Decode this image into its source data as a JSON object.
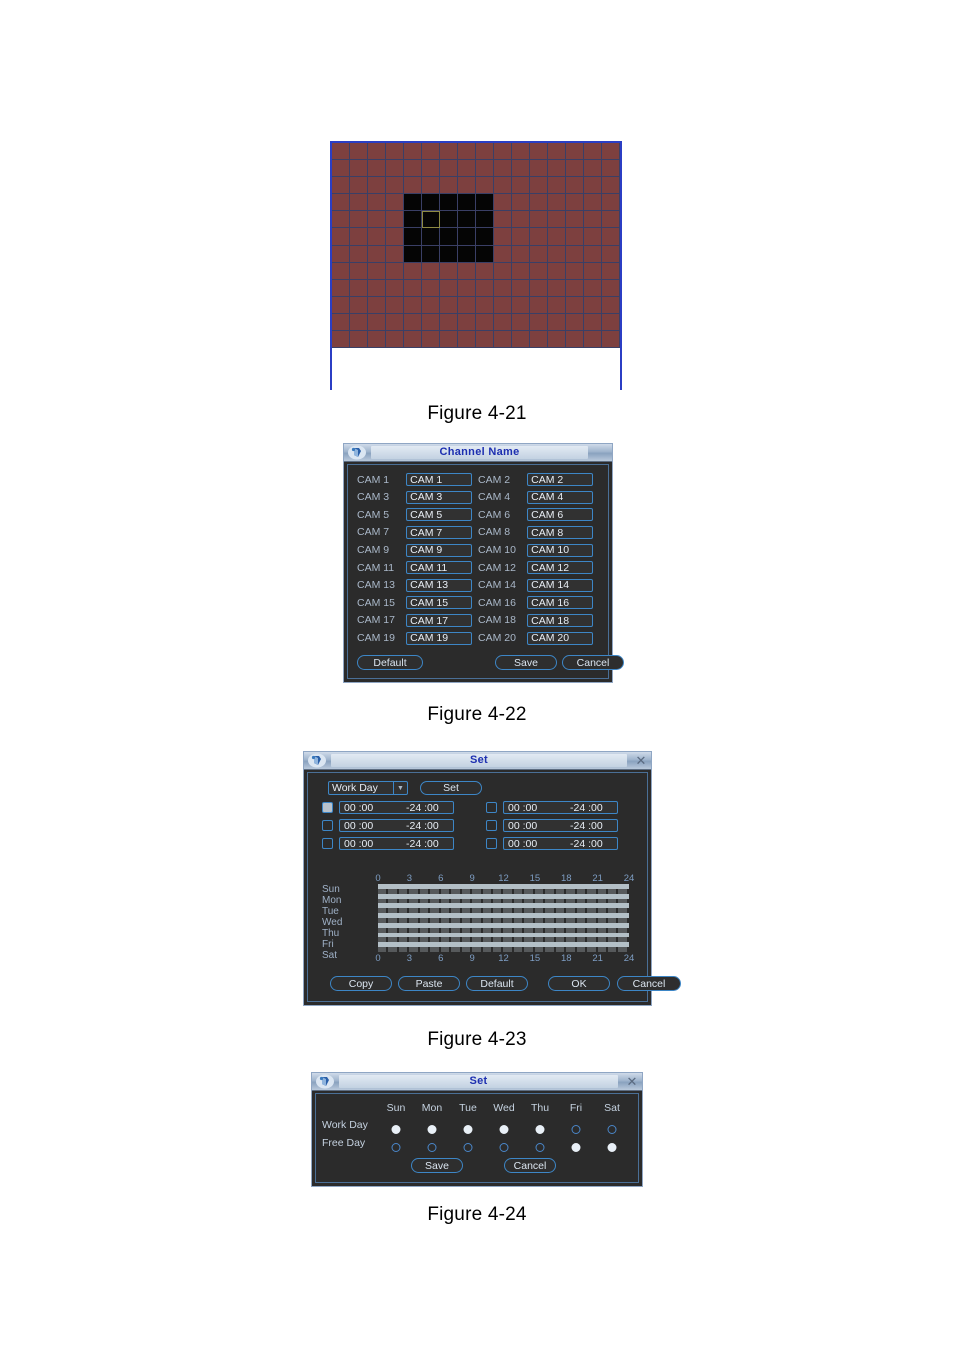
{
  "figures": {
    "fig21_caption": "Figure 4-21",
    "fig22_caption": "Figure 4-22",
    "fig23_caption": "Figure 4-23",
    "fig24_caption": "Figure 4-24"
  },
  "motion_grid": {
    "columns": 16,
    "rows": 12,
    "active_color": "#7d403f",
    "inactive_color": "#050505",
    "gridline_color": "#3a3f66",
    "border_color": "#2b3ec4",
    "cursor_cell": {
      "col": 5,
      "row": 4
    },
    "deselected_region": {
      "col_start": 4,
      "col_end": 8,
      "row_start": 3,
      "row_end": 6
    }
  },
  "channel_name_dialog": {
    "title": "Channel Name",
    "icon": "dvr-logo-icon",
    "rows": [
      {
        "label_left": "CAM 1",
        "value_left": "CAM 1",
        "label_right": "CAM 2",
        "value_right": "CAM 2"
      },
      {
        "label_left": "CAM 3",
        "value_left": "CAM 3",
        "label_right": "CAM 4",
        "value_right": "CAM 4"
      },
      {
        "label_left": "CAM 5",
        "value_left": "CAM 5",
        "label_right": "CAM 6",
        "value_right": "CAM 6"
      },
      {
        "label_left": "CAM 7",
        "value_left": "CAM 7",
        "label_right": "CAM 8",
        "value_right": "CAM 8"
      },
      {
        "label_left": "CAM 9",
        "value_left": "CAM 9",
        "label_right": "CAM 10",
        "value_right": "CAM 10"
      },
      {
        "label_left": "CAM 11",
        "value_left": "CAM 11",
        "label_right": "CAM 12",
        "value_right": "CAM 12"
      },
      {
        "label_left": "CAM 13",
        "value_left": "CAM 13",
        "label_right": "CAM 14",
        "value_right": "CAM 14"
      },
      {
        "label_left": "CAM 15",
        "value_left": "CAM 15",
        "label_right": "CAM 16",
        "value_right": "CAM 16"
      },
      {
        "label_left": "CAM 17",
        "value_left": "CAM 17",
        "label_right": "CAM 18",
        "value_right": "CAM 18"
      },
      {
        "label_left": "CAM 19",
        "value_left": "CAM 19",
        "label_right": "CAM 20",
        "value_right": "CAM 20"
      }
    ],
    "buttons": {
      "default": "Default",
      "save": "Save",
      "cancel": "Cancel"
    }
  },
  "schedule_dialog": {
    "title": "Set",
    "icon": "dvr-logo-icon",
    "close_icon": "close-icon",
    "day_select": {
      "value": "Work Day",
      "options": [
        "Work Day",
        "Free Day"
      ]
    },
    "set_button": "Set",
    "periods": [
      {
        "checked": true,
        "start": "00 :00",
        "end": "-24 :00"
      },
      {
        "checked": false,
        "start": "00 :00",
        "end": "-24 :00"
      },
      {
        "checked": false,
        "start": "00 :00",
        "end": "-24 :00"
      },
      {
        "checked": false,
        "start": "00 :00",
        "end": "-24 :00"
      },
      {
        "checked": false,
        "start": "00 :00",
        "end": "-24 :00"
      },
      {
        "checked": false,
        "start": "00 :00",
        "end": "-24 :00"
      }
    ],
    "timeline": {
      "hour_ticks": [
        "0",
        "3",
        "6",
        "9",
        "12",
        "15",
        "18",
        "21",
        "24"
      ],
      "days": [
        "Sun",
        "Mon",
        "Tue",
        "Wed",
        "Thu",
        "Fri",
        "Sat"
      ],
      "bar_color": "#b3bfc6",
      "segment_color": "#56595b"
    },
    "buttons": {
      "copy": "Copy",
      "paste": "Paste",
      "default": "Default",
      "ok": "OK",
      "cancel": "Cancel"
    }
  },
  "workday_dialog": {
    "title": "Set",
    "icon": "dvr-logo-icon",
    "close_icon": "close-icon",
    "day_headers": [
      "Sun",
      "Mon",
      "Tue",
      "Wed",
      "Thu",
      "Fri",
      "Sat"
    ],
    "row_labels": [
      "Work Day",
      "Free Day"
    ],
    "work_day_selected": [
      true,
      true,
      true,
      true,
      true,
      false,
      false
    ],
    "free_day_selected": [
      false,
      false,
      false,
      false,
      false,
      true,
      true
    ],
    "buttons": {
      "save": "Save",
      "cancel": "Cancel"
    }
  }
}
